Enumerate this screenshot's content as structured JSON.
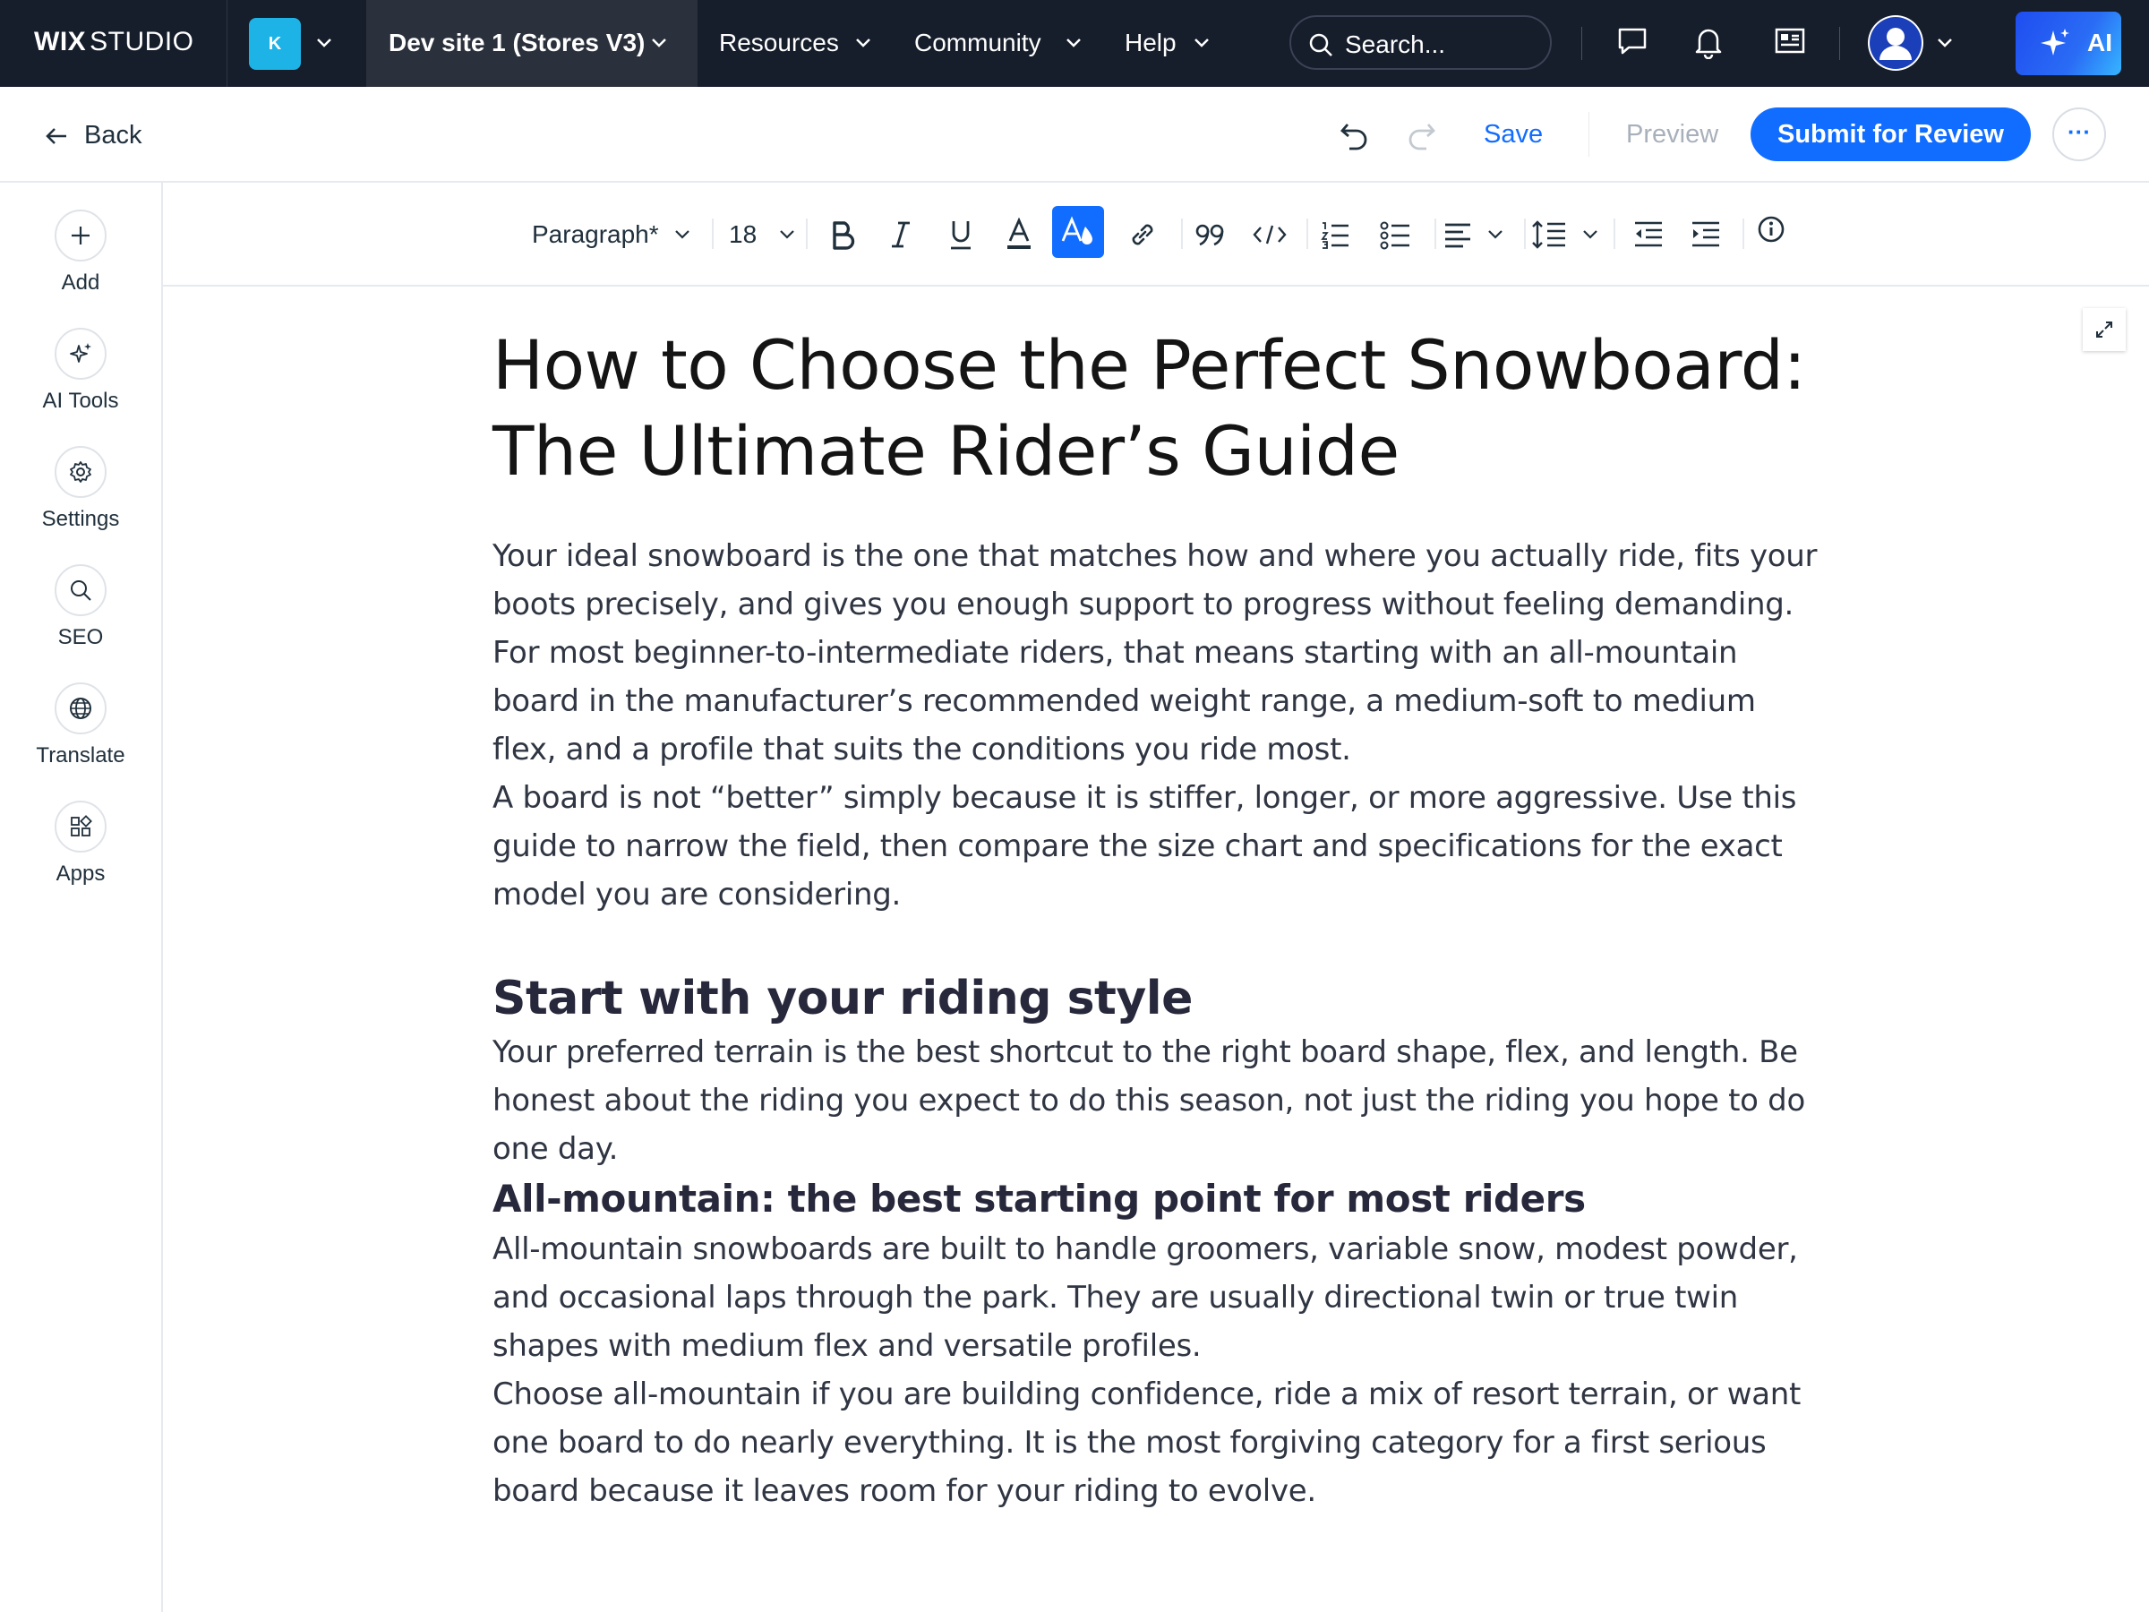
{
  "topnav": {
    "logo_bold": "WIX",
    "logo_light": "STUDIO",
    "workspace_initial": "K",
    "site_name": "Dev site 1 (Stores V3)",
    "nav_items": [
      "Resources",
      "Community",
      "Help"
    ],
    "search_placeholder": "Search...",
    "ai_label": "AI"
  },
  "actionbar": {
    "back_label": "Back",
    "save_label": "Save",
    "preview_label": "Preview",
    "submit_label": "Submit for Review",
    "more_label": "···"
  },
  "rail": {
    "items": [
      {
        "label": "Add",
        "icon": "plus-icon"
      },
      {
        "label": "AI Tools",
        "icon": "sparkle-icon"
      },
      {
        "label": "Settings",
        "icon": "gear-icon"
      },
      {
        "label": "SEO",
        "icon": "search-icon"
      },
      {
        "label": "Translate",
        "icon": "globe-icon"
      },
      {
        "label": "Apps",
        "icon": "apps-icon"
      }
    ]
  },
  "toolbar": {
    "paragraph_style": "Paragraph*",
    "font_size": "18",
    "active_tool": "highlight-color",
    "accent": "#116dff"
  },
  "article": {
    "title": "How to Choose the Perfect Snowboard: The Ultimate Rider’s Guide",
    "intro_1": "Your ideal snowboard is the one that matches how and where you actually ride, fits your boots precisely, and gives you enough support to progress without feeling demanding. For most beginner-to-intermediate riders, that means starting with an all-mountain board in the manufacturer’s recommended weight range, a medium-soft to medium flex, and a profile that suits the conditions you ride most.",
    "intro_2": "A board is not “better” simply because it is stiffer, longer, or more aggressive. Use this guide to narrow the field, then compare the size chart and specifications for the exact model you are considering.",
    "h2_1": "Start with your riding style",
    "p_style": "Your preferred terrain is the best shortcut to the right board shape, flex, and length. Be honest about the riding you expect to do this season, not just the riding you hope to do one day.",
    "h3_1": "All-mountain: the best starting point for most riders",
    "p_allmtn_1": "All-mountain snowboards are built to handle groomers, variable snow, modest powder, and occasional laps through the park. They are usually directional twin or true twin shapes with medium flex and versatile profiles.",
    "p_allmtn_2": "Choose all-mountain if you are building confidence, ride a mix of resort terrain, or want one board to do nearly everything. It is the most forgiving category for a first serious board because it leaves room for your riding to evolve."
  },
  "colors": {
    "nav_bg": "#161d2b",
    "primary": "#116dff",
    "ai_gradient_start": "#1f4df0",
    "ai_gradient_end": "#36b6ff",
    "workspace_badge": "#1eb3e6"
  }
}
